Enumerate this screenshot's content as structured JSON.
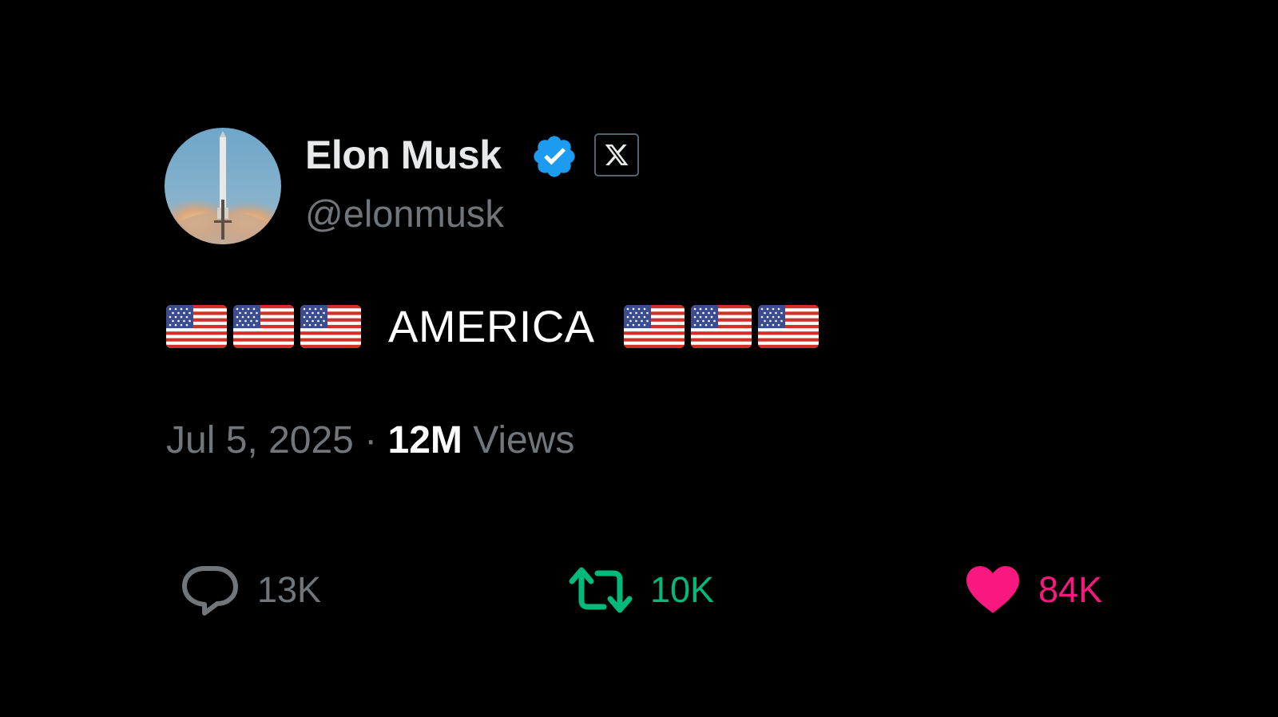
{
  "author": {
    "display_name": "Elon Musk",
    "handle": "@elonmusk",
    "verified_badge_icon": "verified-check-icon",
    "affiliate_badge_icon": "x-logo-icon",
    "avatar_icon": "rocket-launch-avatar"
  },
  "tweet": {
    "flags_before": [
      "🇺🇸",
      "🇺🇸",
      "🇺🇸"
    ],
    "text": "AMERICA",
    "flags_after": [
      "🇺🇸",
      "🇺🇸",
      "🇺🇸"
    ]
  },
  "meta": {
    "date": "Jul 5, 2025",
    "separator": " · ",
    "views_count": "12M",
    "views_label": " Views"
  },
  "actions": {
    "reply": {
      "icon": "comment-bubble-icon",
      "count": "13K"
    },
    "retweet": {
      "icon": "retweet-icon",
      "count": "10K"
    },
    "like": {
      "icon": "heart-icon",
      "count": "84K"
    }
  },
  "colors": {
    "background": "#000000",
    "primary_text": "#e7e9ea",
    "secondary_text": "#71767b",
    "verified_blue": "#1d9bf0",
    "retweet_green": "#00ba7c",
    "like_pink": "#f91880"
  }
}
